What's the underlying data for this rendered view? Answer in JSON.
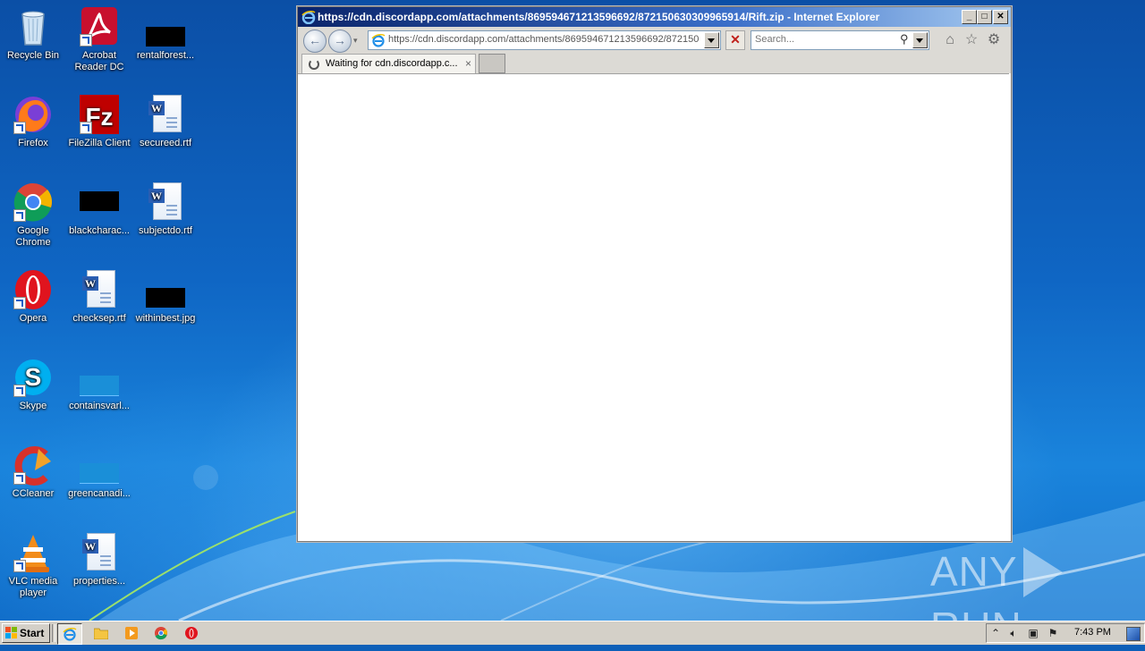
{
  "desktop": {
    "icons": [
      {
        "label": "Recycle Bin"
      },
      {
        "label": "Acrobat Reader DC"
      },
      {
        "label": "rentalforest..."
      },
      {
        "label": "Firefox"
      },
      {
        "label": "FileZilla Client"
      },
      {
        "label": "secureed.rtf"
      },
      {
        "label": "Google Chrome"
      },
      {
        "label": "blackcharac..."
      },
      {
        "label": "subjectdo.rtf"
      },
      {
        "label": "Opera"
      },
      {
        "label": "checksep.rtf"
      },
      {
        "label": "withinbest.jpg"
      },
      {
        "label": "Skype"
      },
      {
        "label": "containsvarl..."
      },
      {
        "label": "CCleaner"
      },
      {
        "label": "greencanadi..."
      },
      {
        "label": "VLC media player"
      },
      {
        "label": "properties..."
      }
    ]
  },
  "browser": {
    "window_title": "https://cdn.discordapp.com/attachments/869594671213596692/872150630309965914/Rift.zip - Internet Explorer",
    "address": "https://cdn.discordapp.com/attachments/869594671213596692/872150",
    "search_placeholder": "Search...",
    "tab_label": "Waiting for cdn.discordapp.c...",
    "tab_close": "×",
    "stop_glyph": "✕"
  },
  "watermark": {
    "left": "ANY",
    "right": "RUN"
  },
  "taskbar": {
    "start_label": "Start",
    "clock": "7:43 PM"
  },
  "colors": {
    "titlebar_start": "#0a246a",
    "titlebar_end": "#a6caf0",
    "taskbar": "#d4d0c8",
    "wallpaper": "#0f66c4"
  }
}
